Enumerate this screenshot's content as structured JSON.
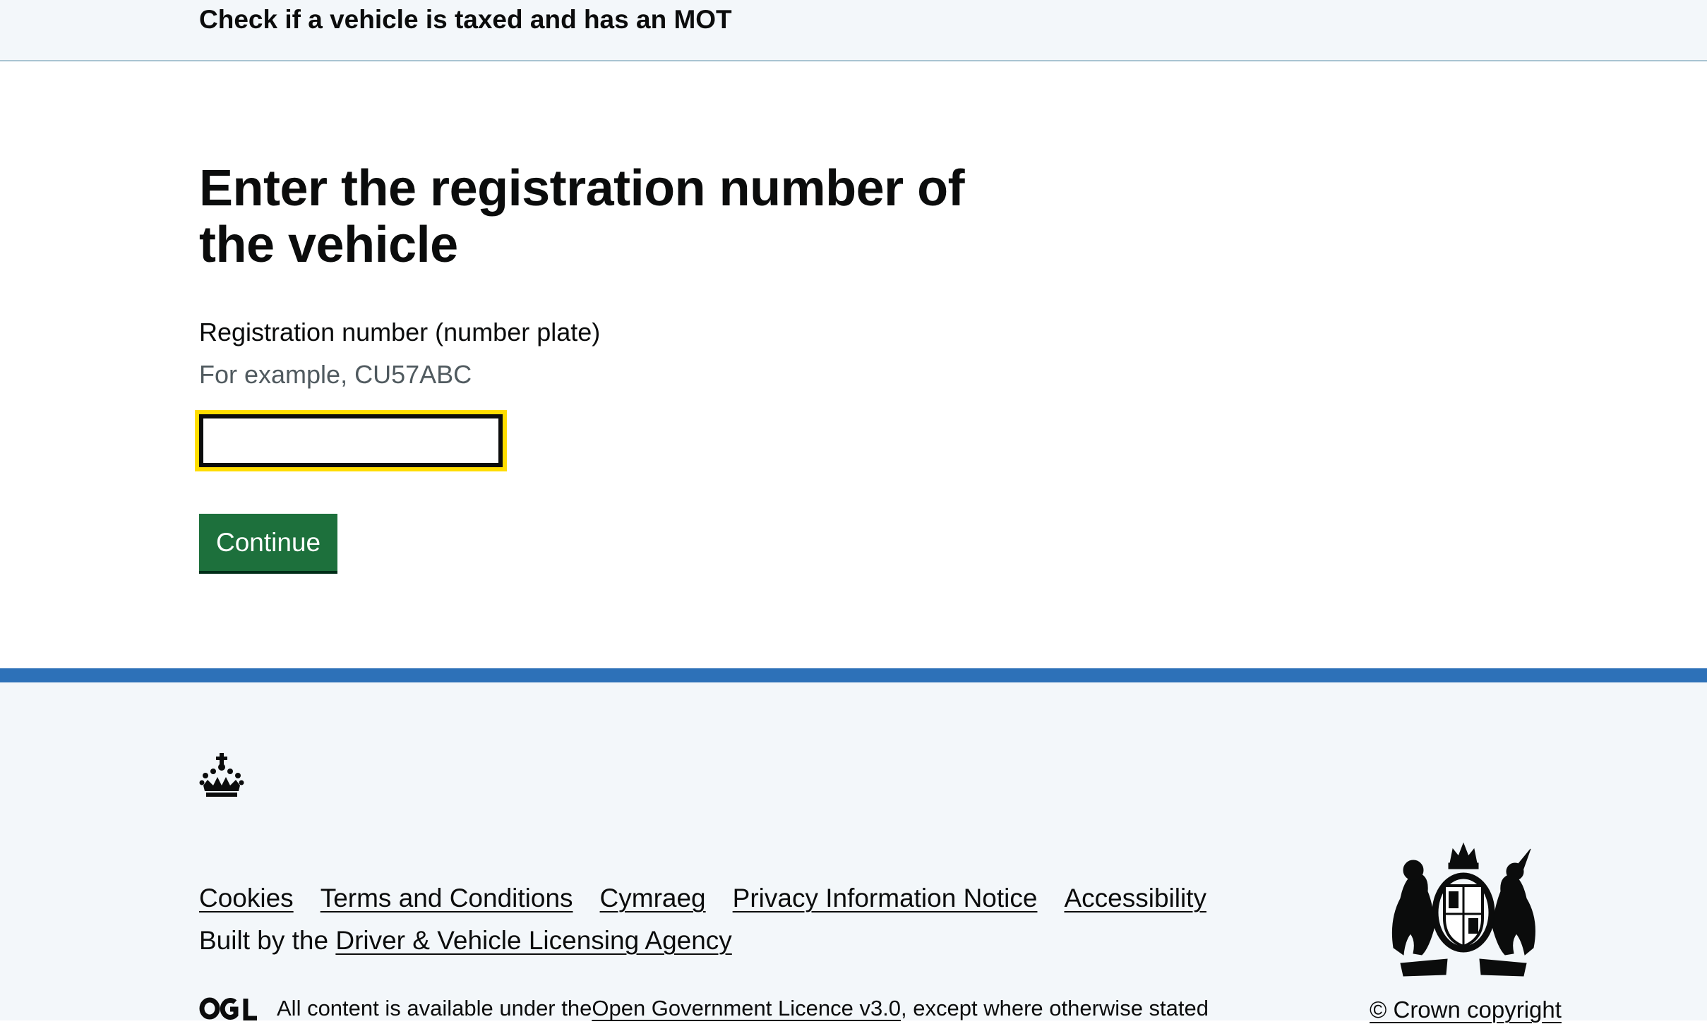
{
  "header": {
    "service_name": "Check if a vehicle is taxed and has an MOT"
  },
  "main": {
    "title": "Enter the registration number of the vehicle",
    "field_label": "Registration number (number plate)",
    "field_hint": "For example, CU57ABC",
    "input_value": "",
    "continue_label": "Continue"
  },
  "footer": {
    "links": [
      "Cookies",
      "Terms and Conditions",
      "Cymraeg",
      "Privacy Information Notice",
      "Accessibility"
    ],
    "built_by_prefix": "Built by the ",
    "built_by_link": "Driver & Vehicle Licensing Agency",
    "licence_prefix": "All content is available under the ",
    "licence_link": "Open Government Licence v3.0",
    "licence_suffix": ", except where otherwise stated",
    "copyright": "© Crown copyright",
    "icons": [
      "crown-icon",
      "ogl-icon",
      "royal-coat-of-arms-icon"
    ],
    "accent_color": "#2d71b8",
    "button_color": "#1d703c",
    "focus_color": "#ffdd00"
  }
}
